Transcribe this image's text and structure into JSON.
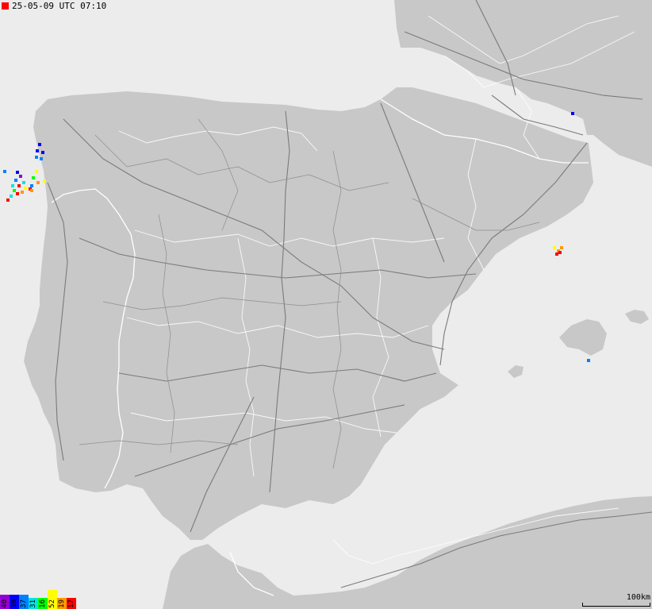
{
  "timestamp": {
    "text": "25-05-09 UTC 07:10",
    "marker_color": "#ff0000"
  },
  "scale": {
    "label": "100km"
  },
  "legend": {
    "bins": [
      {
        "label": "40",
        "color": "#9400d3",
        "level": 0.18
      },
      {
        "label": "38",
        "color": "#0000ff",
        "level": 0.18
      },
      {
        "label": "37",
        "color": "#0080ff",
        "level": 0.18
      },
      {
        "label": "31",
        "color": "#00e5e5",
        "level": 0.14
      },
      {
        "label": "16",
        "color": "#00ff00",
        "level": 0.04
      },
      {
        "label": "52",
        "color": "#ffff00",
        "level": 0.24
      },
      {
        "label": "19",
        "color": "#ff9900",
        "level": 0.08
      },
      {
        "label": "17",
        "color": "#ff0000",
        "level": 0.08
      }
    ]
  },
  "colors": {
    "sea": "#ececec",
    "land": "#c8c8c8",
    "borders": "#ffffff",
    "roads": "#7a7a7a"
  }
}
